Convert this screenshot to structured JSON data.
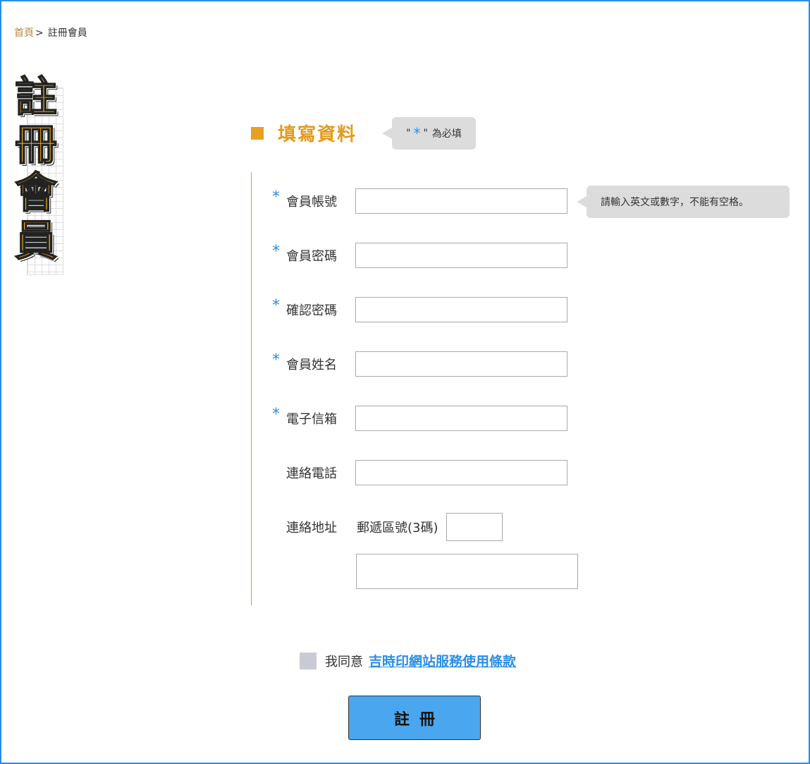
{
  "breadcrumb": {
    "home": "首頁",
    "separator": ">",
    "current": "註冊會員"
  },
  "side_title": [
    "註",
    "冊",
    "會",
    "員"
  ],
  "section": {
    "title": "填寫資料",
    "required_hint": {
      "quote_open": "\"",
      "star": "*",
      "quote_close": "\"",
      "text": "為必填"
    }
  },
  "account_hint": "請輸入英文或數字，不能有空格。",
  "fields": [
    {
      "required": true,
      "label": "會員帳號",
      "value": ""
    },
    {
      "required": true,
      "label": "會員密碼",
      "value": ""
    },
    {
      "required": true,
      "label": "確認密碼",
      "value": ""
    },
    {
      "required": true,
      "label": "會員姓名",
      "value": ""
    },
    {
      "required": true,
      "label": "電子信箱",
      "value": ""
    },
    {
      "required": false,
      "label": "連絡電話",
      "value": ""
    }
  ],
  "address": {
    "label": "連絡地址",
    "zip_label": "郵遞區號(3碼)",
    "zip_value": "",
    "address_value": ""
  },
  "agreement": {
    "text": "我同意",
    "link": "吉時印網站服務使用條款",
    "checked": false
  },
  "submit_label": "註冊",
  "colors": {
    "accent_blue": "#2a8ee6",
    "accent_orange": "#e39a1e",
    "button_blue": "#4aa6ee"
  }
}
